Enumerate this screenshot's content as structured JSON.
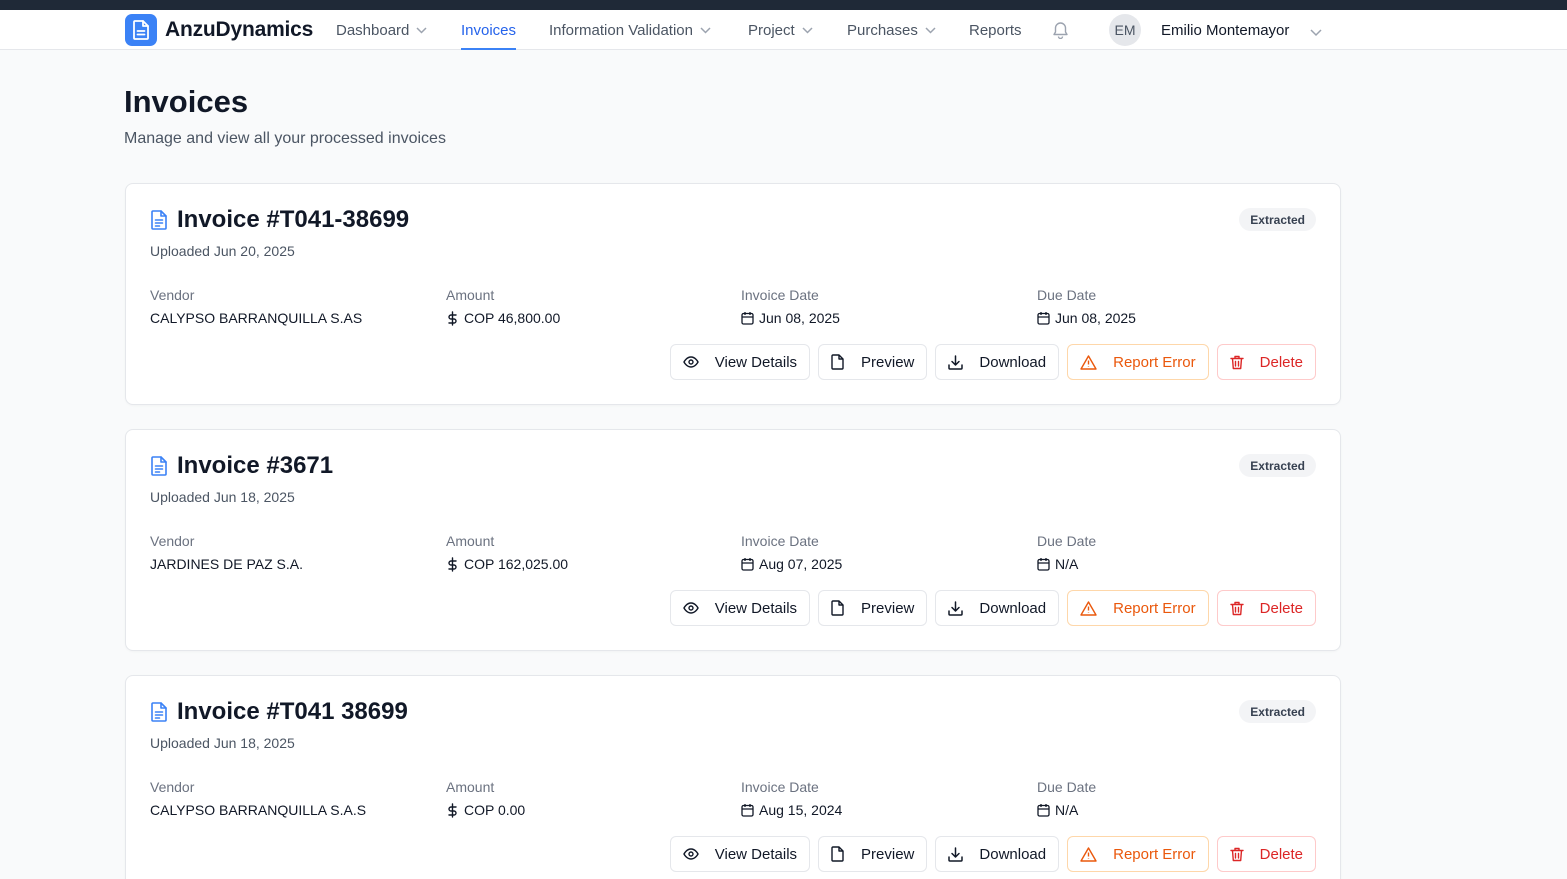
{
  "brand": {
    "name": "AnzuDynamics",
    "icon": "document-icon",
    "color": "#3b82f6"
  },
  "nav": {
    "items": [
      {
        "label": "Dashboard",
        "has_dropdown": true
      },
      {
        "label": "Invoices",
        "active": true
      },
      {
        "label": "Information Validation",
        "has_dropdown": true
      },
      {
        "label": "Project",
        "has_dropdown": true
      },
      {
        "label": "Purchases",
        "has_dropdown": true
      },
      {
        "label": "Reports"
      }
    ],
    "notifications_icon": "bell-icon"
  },
  "user": {
    "initials": "EM",
    "name": "Emilio Montemayor"
  },
  "page": {
    "title": "Invoices",
    "subtitle": "Manage and view all your processed invoices"
  },
  "labels": {
    "vendor": "Vendor",
    "amount": "Amount",
    "invoice_date": "Invoice Date",
    "due_date": "Due Date"
  },
  "actions": {
    "view_details": "View Details",
    "preview": "Preview",
    "download": "Download",
    "report_error": "Report Error",
    "delete": "Delete"
  },
  "invoices": [
    {
      "title": "Invoice #T041-38699",
      "uploaded": "Uploaded Jun 20, 2025",
      "status": "Extracted",
      "vendor": "CALYPSO BARRANQUILLA S.AS",
      "amount": "COP 46,800.00",
      "invoice_date": "Jun 08, 2025",
      "due_date": "Jun 08, 2025"
    },
    {
      "title": "Invoice #3671",
      "uploaded": "Uploaded Jun 18, 2025",
      "status": "Extracted",
      "vendor": "JARDINES DE PAZ S.A.",
      "amount": "COP 162,025.00",
      "invoice_date": "Aug 07, 2025",
      "due_date": "N/A"
    },
    {
      "title": "Invoice #T041 38699",
      "uploaded": "Uploaded Jun 18, 2025",
      "status": "Extracted",
      "vendor": "CALYPSO BARRANQUILLA S.A.S",
      "amount": "COP 0.00",
      "invoice_date": "Aug 15, 2024",
      "due_date": "N/A"
    }
  ],
  "colors": {
    "accent": "#2563eb",
    "warning": "#ea580c",
    "danger": "#dc2626"
  }
}
